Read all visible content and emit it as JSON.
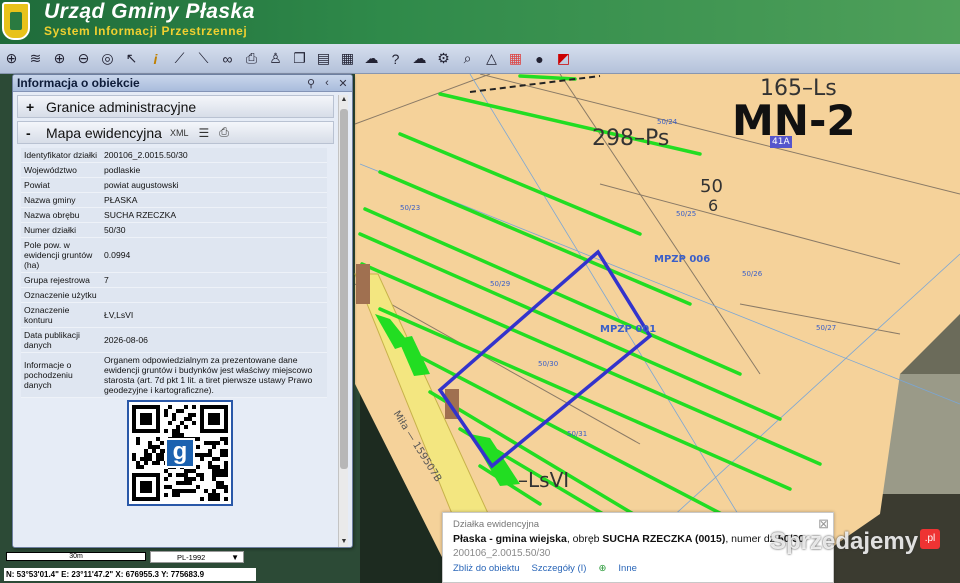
{
  "header": {
    "title": "Urząd Gminy Płaska",
    "subtitle": "System Informacji Przestrzennej"
  },
  "toolbar": {
    "tools": [
      "grid-icon",
      "layers-icon",
      "zoom-in-icon",
      "zoom-out-icon",
      "zoom-extent-icon",
      "pointer-icon",
      "info-icon",
      "measure-icon",
      "ruler-icon",
      "link-icon",
      "print-icon",
      "person-icon",
      "copy-icon",
      "layout-icon",
      "table-icon",
      "chat-icon",
      "help-icon",
      "cloud-icon",
      "settings-icon",
      "search-map-icon",
      "triangle-icon",
      "colors-icon",
      "pin-icon",
      "close-box-icon"
    ]
  },
  "panel": {
    "title": "Informacja o obiekcie",
    "section1": {
      "sym": "+",
      "label": "Granice administracyjne"
    },
    "section2": {
      "sym": "-",
      "label": "Mapa ewidencyjna",
      "xml": "XML"
    },
    "rows": [
      {
        "k": "Identyfikator działki",
        "v": "200106_2.0015.50/30"
      },
      {
        "k": "Województwo",
        "v": "podlaskie"
      },
      {
        "k": "Powiat",
        "v": "powiat augustowski"
      },
      {
        "k": "Nazwa gminy",
        "v": "PŁASKA"
      },
      {
        "k": "Nazwa obrębu",
        "v": "SUCHA RZECZKA"
      },
      {
        "k": "Numer działki",
        "v": "50/30"
      },
      {
        "k": "Pole pow. w ewidencji gruntów (ha)",
        "v": "0.0994"
      },
      {
        "k": "Grupa rejestrowa",
        "v": "7"
      },
      {
        "k": "Oznaczenie użytku",
        "v": ""
      },
      {
        "k": "Oznaczenie konturu",
        "v": "ŁV,LsVI"
      },
      {
        "k": "Data publikacji danych",
        "v": "2026-08-06"
      },
      {
        "k": "Informacje o pochodzeniu danych",
        "v": "Organem odpowiedzialnym za prezentowane dane ewidencji gruntów i budynków jest właściwy miejscowo starosta (art. 7d pkt 1 lit. a tiret pierwsze ustawy Prawo geodezyjne i kartograficzne)."
      }
    ],
    "qr_logo": "g"
  },
  "status": {
    "scale": "30m",
    "crs": "PL-1992",
    "coords": "N: 53°53'01.4\"  E: 23°11'47.2\"  X: 676955.3  Y: 775683.9"
  },
  "map": {
    "labels": {
      "ls165": "165–Ls",
      "mn2": "MN-2",
      "ps298": "298–Ps",
      "badge": "41A",
      "n50": "50",
      "n6": "6",
      "mpzp006": "MPZP 006",
      "mpzp001": "MPZP 001",
      "p5024": "50/24",
      "p5025": "50/25",
      "p5026": "50/26",
      "p5027": "50/27",
      "p5029": "50/29",
      "p5030": "50/30",
      "p5031": "50/31",
      "p5023": "50/23",
      "lsvi": "–LsVI",
      "road": "Miła — 159507B"
    }
  },
  "popup": {
    "caption": "Działka ewidencyjna",
    "place": "Płaska - gmina wiejska",
    "obreb_prefix": ", obręb ",
    "obreb": "SUCHA RZECZKA (0015)",
    "numer_prefix": ", numer dz ",
    "numer": "50/30",
    "id": "200106_2.0015.50/30",
    "links": [
      "Zbliż do obiektu",
      "Szczegóły (I)",
      "Inne"
    ]
  },
  "watermark": {
    "text": "Sprzedajemy",
    "badge": ".pl"
  },
  "colors": {
    "parcel_fill": "#f5d29a",
    "green_lines": "#22dd22",
    "selection": "#3333cc",
    "header": "#2f8a4a"
  }
}
